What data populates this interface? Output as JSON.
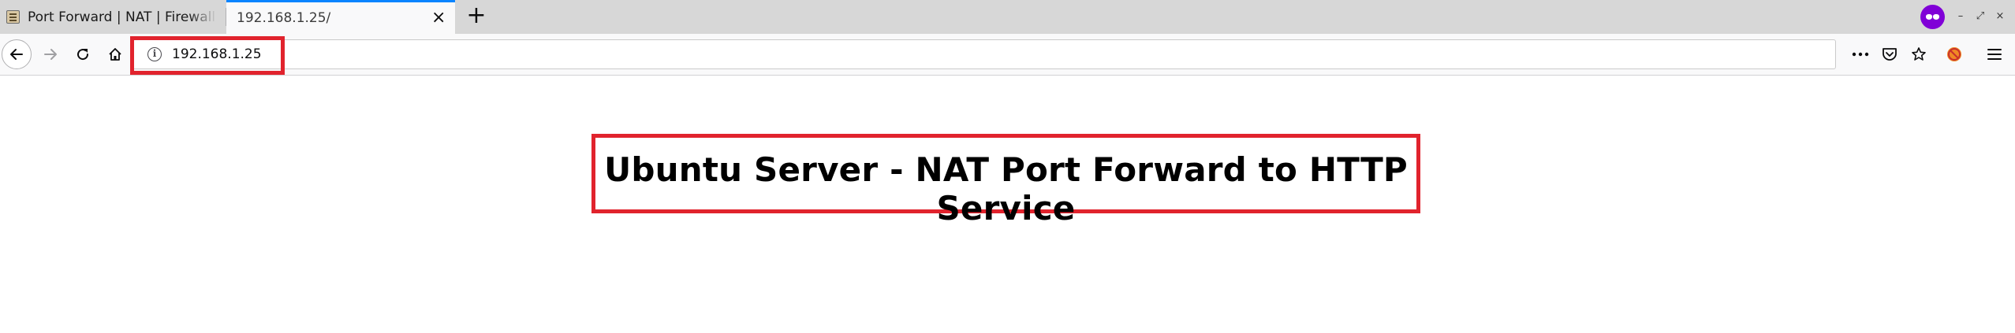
{
  "browser": {
    "tabs": [
      {
        "title": "Port Forward | NAT | Firewall",
        "active": false
      },
      {
        "title": "192.168.1.25/",
        "active": true
      }
    ],
    "new_tab_icon": "plus-icon",
    "private_icon": "private-browsing-mask-icon",
    "window_controls": [
      "–",
      "⤢",
      "×"
    ],
    "accent_color": "#0a84ff",
    "private_color": "#8000d7"
  },
  "navbar": {
    "url": "192.168.1.25",
    "icons": [
      "back-arrow-icon",
      "forward-arrow-icon",
      "reload-icon",
      "home-icon",
      "site-info-icon",
      "more-actions-icon",
      "pocket-icon",
      "bookmark-star-icon",
      "blocked-addon-icon",
      "hamburger-menu-icon"
    ]
  },
  "page": {
    "heading": "Ubuntu Server - NAT Port Forward to HTTP Service",
    "highlight_color": "#e1232d"
  }
}
